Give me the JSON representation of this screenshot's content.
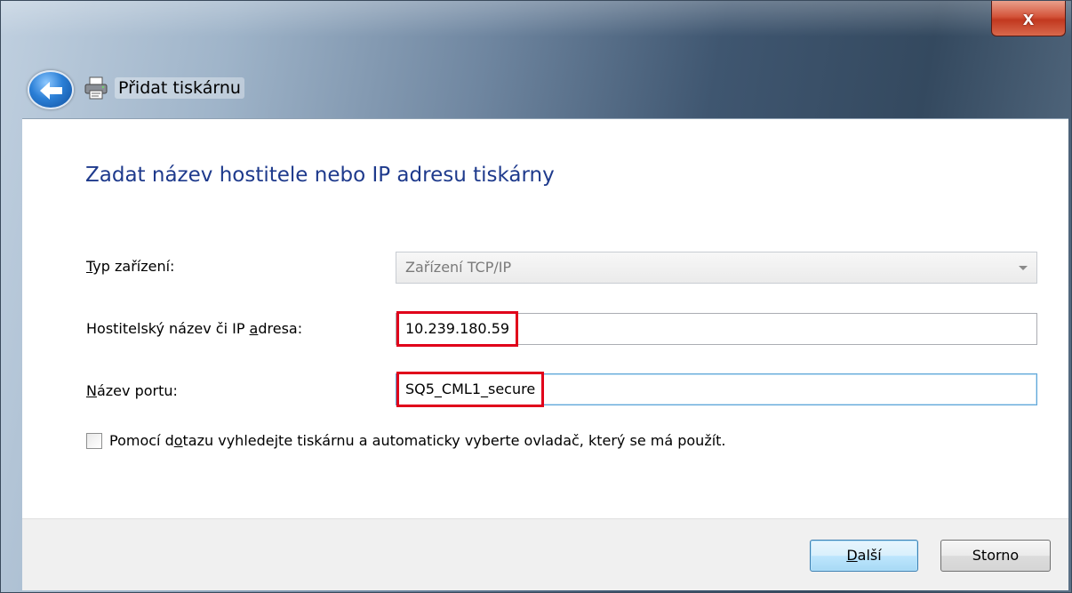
{
  "window": {
    "title": "Přidat tiskárnu",
    "close_glyph": "x"
  },
  "page": {
    "heading": "Zadat název hostitele nebo IP adresu tiskárny"
  },
  "form": {
    "device_type": {
      "label_pre": "",
      "label_key": "T",
      "label_post": "yp zařízení:",
      "value": "Zařízení TCP/IP"
    },
    "host": {
      "label_pre": "Hostitelský název či IP ",
      "label_key": "a",
      "label_post": "dresa:",
      "value": "10.239.180.59"
    },
    "port": {
      "label_pre": "",
      "label_key": "N",
      "label_post": "ázev portu:",
      "value": "SQ5_CML1_secure"
    },
    "query_checkbox": {
      "label_pre": "Pomocí d",
      "label_key": "o",
      "label_post": "tazu vyhledejte tiskárnu a automaticky vyberte ovladač, který se má použít.",
      "checked": false
    }
  },
  "footer": {
    "next": {
      "label_key": "D",
      "label_post": "alší"
    },
    "cancel": {
      "label": "Storno"
    }
  },
  "colors": {
    "heading": "#1e3a8c",
    "highlight_border": "#e0001a"
  },
  "icons": {
    "back": "back-arrow-icon",
    "printer": "printer-icon",
    "close": "close-icon",
    "dropdown": "chevron-down-icon"
  }
}
